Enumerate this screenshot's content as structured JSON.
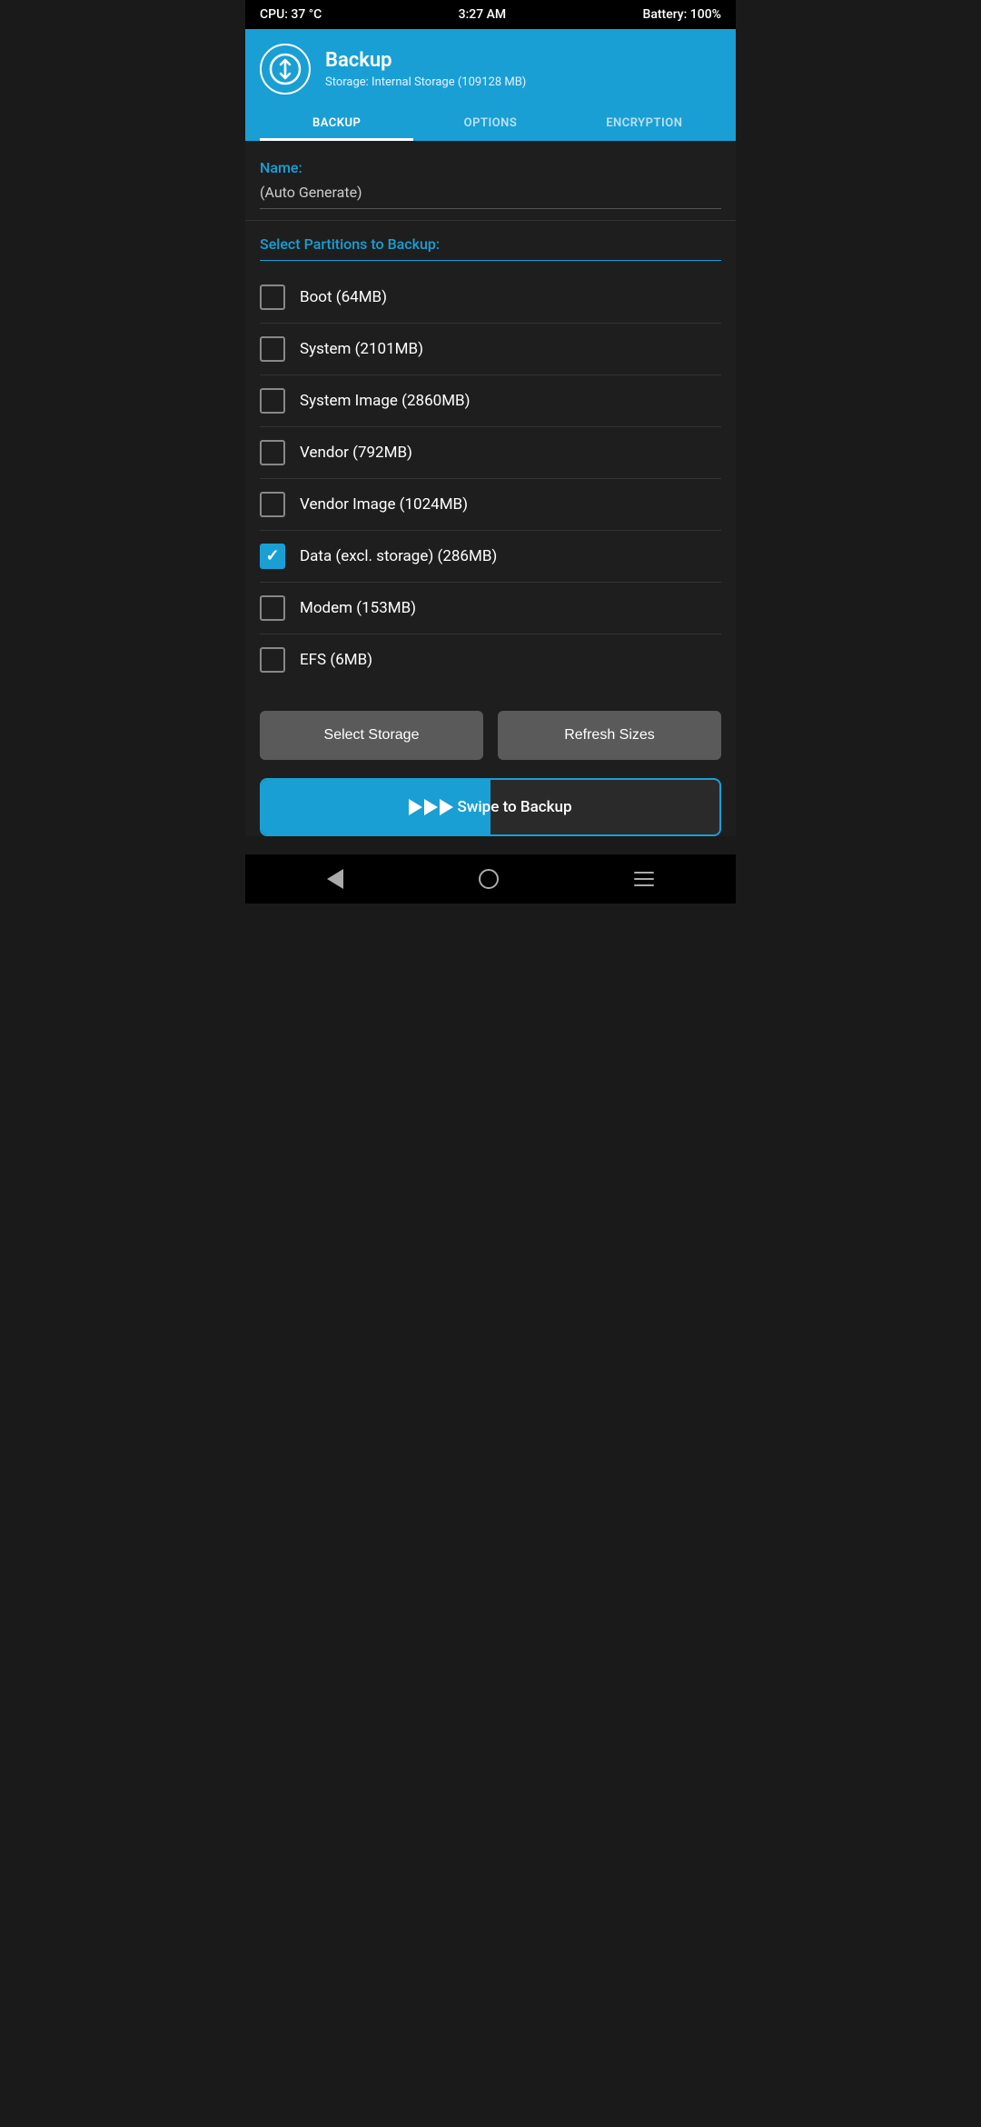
{
  "status_bar": {
    "cpu": "CPU: 37 °C",
    "time": "3:27 AM",
    "battery": "Battery: 100%"
  },
  "header": {
    "app_name": "Backup",
    "subtitle": "Storage: Internal Storage (109128 MB)"
  },
  "tabs": [
    {
      "id": "backup",
      "label": "BACKUP",
      "active": true
    },
    {
      "id": "options",
      "label": "OPTIONS",
      "active": false
    },
    {
      "id": "encryption",
      "label": "ENCRYPTION",
      "active": false
    }
  ],
  "name_field": {
    "label": "Name:",
    "value": "(Auto Generate)"
  },
  "partitions": {
    "section_label": "Select Partitions to Backup:",
    "items": [
      {
        "id": "boot",
        "label": "Boot (64MB)",
        "checked": false
      },
      {
        "id": "system",
        "label": "System (2101MB)",
        "checked": false
      },
      {
        "id": "system_image",
        "label": "System Image (2860MB)",
        "checked": false
      },
      {
        "id": "vendor",
        "label": "Vendor (792MB)",
        "checked": false
      },
      {
        "id": "vendor_image",
        "label": "Vendor Image (1024MB)",
        "checked": false
      },
      {
        "id": "data",
        "label": "Data (excl. storage) (286MB)",
        "checked": true
      },
      {
        "id": "modem",
        "label": "Modem (153MB)",
        "checked": false
      },
      {
        "id": "efs",
        "label": "EFS (6MB)",
        "checked": false
      }
    ]
  },
  "buttons": {
    "select_storage": "Select Storage",
    "refresh_sizes": "Refresh Sizes"
  },
  "swipe": {
    "text": "Swipe to Backup"
  }
}
